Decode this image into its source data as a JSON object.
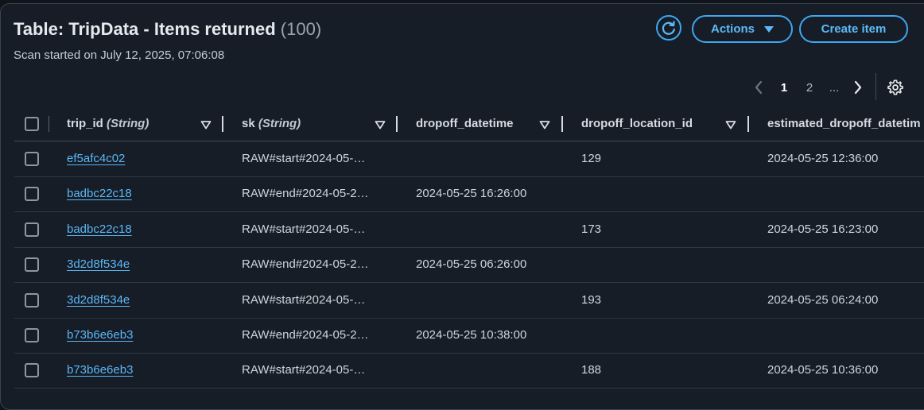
{
  "header": {
    "title": "Table: TripData - Items returned",
    "count": "(100)",
    "subtitle": "Scan started on July 12, 2025, 07:06:08",
    "actions_label": "Actions",
    "create_label": "Create item"
  },
  "pagination": {
    "current_page": "1",
    "next_page": "2",
    "ellipsis": "..."
  },
  "table": {
    "columns": [
      {
        "name": "trip_id",
        "type": "(String)"
      },
      {
        "name": "sk",
        "type": "(String)"
      },
      {
        "name": "dropoff_datetime",
        "type": ""
      },
      {
        "name": "dropoff_location_id",
        "type": ""
      },
      {
        "name": "estimated_dropoff_datetim",
        "type": ""
      }
    ],
    "rows": [
      {
        "trip_id": "ef5afc4c02",
        "sk": "RAW#start#2024-05-…",
        "dropoff_datetime": "",
        "dropoff_location_id": "129",
        "estimated": "2024-05-25 12:36:00"
      },
      {
        "trip_id": "badbc22c18",
        "sk": "RAW#end#2024-05-2…",
        "dropoff_datetime": "2024-05-25 16:26:00",
        "dropoff_location_id": "",
        "estimated": ""
      },
      {
        "trip_id": "badbc22c18",
        "sk": "RAW#start#2024-05-…",
        "dropoff_datetime": "",
        "dropoff_location_id": "173",
        "estimated": "2024-05-25 16:23:00"
      },
      {
        "trip_id": "3d2d8f534e",
        "sk": "RAW#end#2024-05-2…",
        "dropoff_datetime": "2024-05-25 06:26:00",
        "dropoff_location_id": "",
        "estimated": ""
      },
      {
        "trip_id": "3d2d8f534e",
        "sk": "RAW#start#2024-05-…",
        "dropoff_datetime": "",
        "dropoff_location_id": "193",
        "estimated": "2024-05-25 06:24:00"
      },
      {
        "trip_id": "b73b6e6eb3",
        "sk": "RAW#end#2024-05-2…",
        "dropoff_datetime": "2024-05-25 10:38:00",
        "dropoff_location_id": "",
        "estimated": ""
      },
      {
        "trip_id": "b73b6e6eb3",
        "sk": "RAW#start#2024-05-…",
        "dropoff_datetime": "",
        "dropoff_location_id": "188",
        "estimated": "2024-05-25 10:36:00"
      }
    ]
  },
  "icons": {
    "refresh": "refresh-icon",
    "actions_caret": "caret-down-icon",
    "prev": "chevron-left-icon",
    "next": "chevron-right-icon",
    "settings": "gear-icon",
    "sort": "sort-down-icon"
  },
  "colors": {
    "accent": "#3ea7f0",
    "link": "#5cb6f6",
    "background": "#161d26"
  }
}
